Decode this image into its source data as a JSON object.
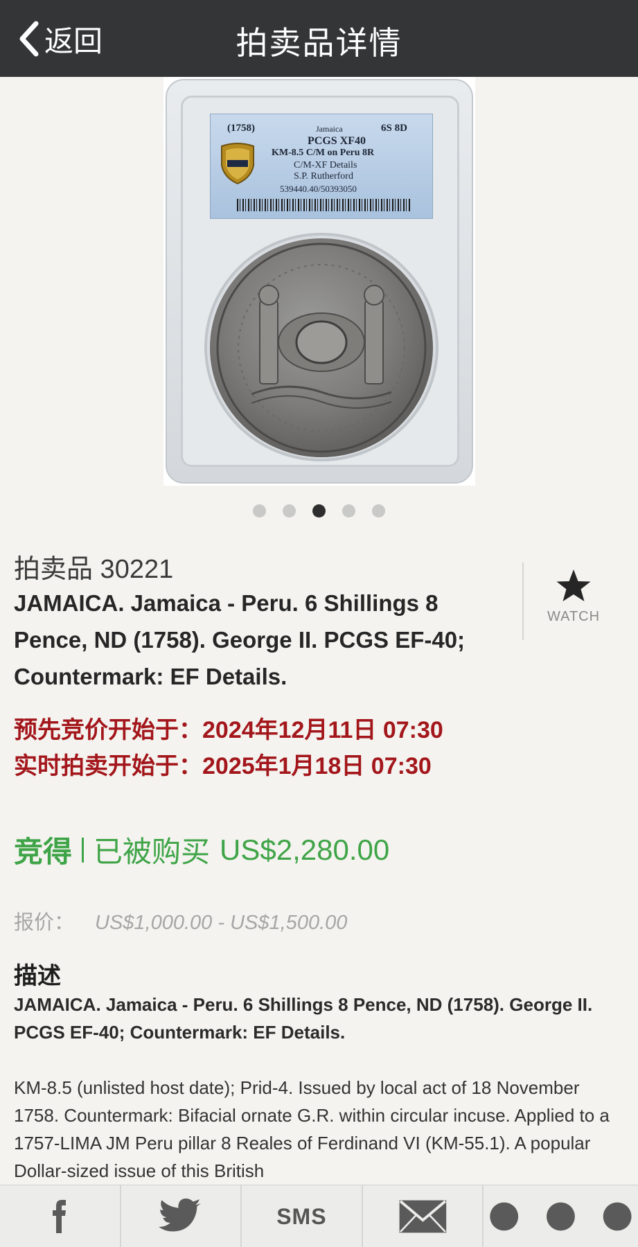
{
  "header": {
    "back_label": "返回",
    "title": "拍卖品详情"
  },
  "image": {
    "slab_label": {
      "year": "(1758)",
      "country": "Jamaica",
      "denomination": "6S 8D",
      "grade": "PCGS XF40",
      "catalog": "KM-8.5 C/M on Peru 8R",
      "details": "C/M-XF Details",
      "pedigree": "S.P. Rutherford",
      "cert": "539440.40/50393050"
    },
    "carousel": {
      "count": 5,
      "active_index": 3
    }
  },
  "lot": {
    "label": "拍卖品 30221",
    "title": "JAMAICA. Jamaica - Peru. 6 Shillings 8 Pence, ND (1758). George II. PCGS EF-40; Countermark: EF Details."
  },
  "watch": {
    "label": "WATCH"
  },
  "dates": {
    "prebid": "预先竞价开始于：2024年12月11日 07:30",
    "live": "实时拍卖开始于：2025年1月18日 07:30"
  },
  "result": {
    "won": "竞得",
    "status": "已被购买",
    "price": "US$2,280.00"
  },
  "estimate": {
    "label": "报价：",
    "value": "US$1,000.00 - US$1,500.00"
  },
  "description": {
    "heading": "描述",
    "summary": "JAMAICA. Jamaica - Peru. 6 Shillings 8 Pence, ND (1758). George II. PCGS EF-40; Countermark: EF Details.",
    "body": "KM-8.5 (unlisted host date); Prid-4. Issued by local act of 18 November 1758. Countermark: Bifacial ornate G.R. within circular incuse. Applied to a 1757-LIMA JM Peru pillar 8 Reales of Ferdinand VI (KM-55.1). A popular Dollar-sized issue of this British"
  },
  "share": {
    "items": [
      "facebook-icon",
      "twitter-icon",
      "sms",
      "mail-icon",
      "more-icon"
    ],
    "sms_label": "SMS"
  },
  "colors": {
    "header_bg": "#333537",
    "date_red": "#a3161b",
    "sold_green": "#3fa447",
    "background": "#f4f3ef"
  }
}
